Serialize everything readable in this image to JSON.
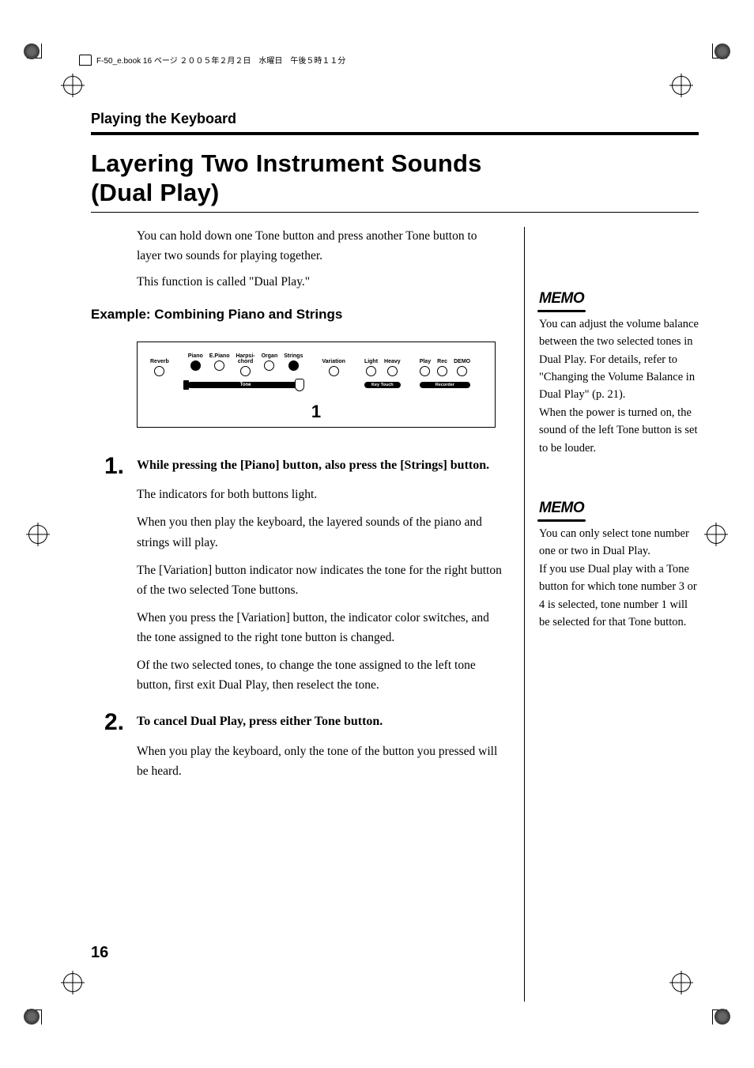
{
  "header_strip": "F-50_e.book  16 ページ  ２００５年２月２日　水曜日　午後５時１１分",
  "running_head": "Playing the Keyboard",
  "title_line1": "Layering Two Instrument Sounds",
  "title_line2": "(Dual Play)",
  "intro": {
    "p1": "You can hold down one Tone button and press another Tone button to layer two sounds for playing together.",
    "p2": "This function is called \"Dual Play.\""
  },
  "subhead": "Example: Combining Piano and Strings",
  "panel": {
    "reverb": "Reverb",
    "tones": [
      "Piano",
      "E.Piano",
      "Harpsi-\nchord",
      "Organ",
      "Strings"
    ],
    "tone_bar": "Tone",
    "variation": "Variation",
    "key_touch": {
      "labels": [
        "Light",
        "Heavy"
      ],
      "pill": "Key Touch"
    },
    "recorder": {
      "labels": [
        "Play",
        "Rec",
        "DEMO"
      ],
      "pill": "Recorder"
    },
    "callout": "1"
  },
  "steps": [
    {
      "num": "1",
      "lead": "While pressing the [Piano] button, also press the [Strings] button.",
      "paras": [
        "The indicators for both buttons light.",
        "When you then play the keyboard, the layered sounds of the piano and strings will play.",
        "The [Variation] button indicator now indicates the tone for the right button of the two selected Tone buttons.",
        "When you press the [Variation] button, the indicator color switches, and the tone assigned to the right tone button is changed.",
        "Of the two selected tones, to change the tone assigned to the left tone button, first exit Dual Play, then reselect the tone."
      ]
    },
    {
      "num": "2",
      "lead": "To cancel Dual Play, press either Tone button.",
      "paras": [
        "When you play the keyboard, only the tone of the button you pressed will be heard."
      ]
    }
  ],
  "memos": [
    {
      "label": "MEMO",
      "text": "You can adjust the volume balance between the two selected tones in Dual Play. For details, refer to \"Changing the Volume Balance in Dual Play\" (p. 21).\nWhen the power is turned on, the sound of the left Tone button is set to be louder."
    },
    {
      "label": "MEMO",
      "text": "You can only select tone number one or two in Dual Play.\nIf you use Dual play with a Tone button for which tone number 3 or 4 is selected, tone number 1 will be selected for that Tone button."
    }
  ],
  "page_number": "16"
}
